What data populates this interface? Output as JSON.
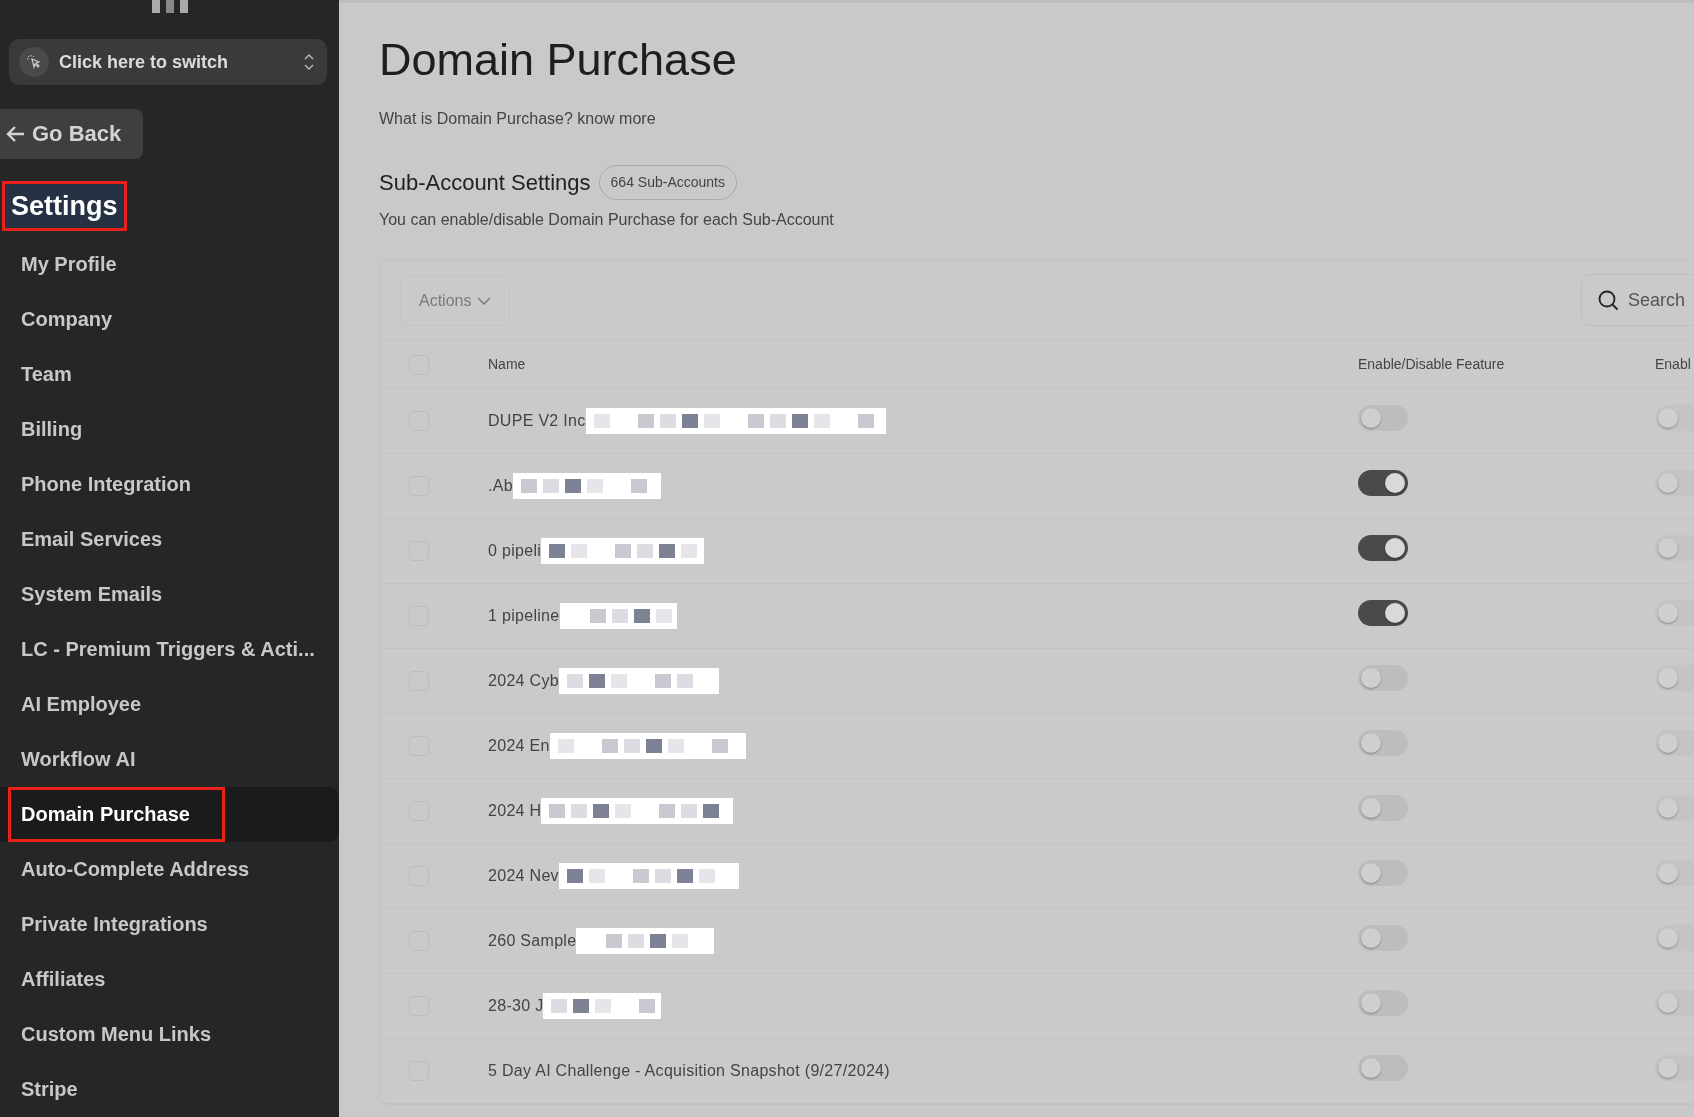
{
  "sidebar": {
    "switcher": {
      "label": "Click here to switch"
    },
    "back_button": "Go Back",
    "heading": {
      "text": "Settings",
      "annotated": true
    },
    "items": [
      {
        "label": "My Profile",
        "selected": false,
        "annotated": false
      },
      {
        "label": "Company",
        "selected": false,
        "annotated": false
      },
      {
        "label": "Team",
        "selected": false,
        "annotated": false
      },
      {
        "label": "Billing",
        "selected": false,
        "annotated": false
      },
      {
        "label": "Phone Integration",
        "selected": false,
        "annotated": false
      },
      {
        "label": "Email Services",
        "selected": false,
        "annotated": false
      },
      {
        "label": "System Emails",
        "selected": false,
        "annotated": false
      },
      {
        "label": "LC - Premium Triggers & Acti...",
        "selected": false,
        "annotated": false
      },
      {
        "label": "AI Employee",
        "selected": false,
        "annotated": false
      },
      {
        "label": "Workflow AI",
        "selected": false,
        "annotated": false
      },
      {
        "label": "Domain Purchase",
        "selected": true,
        "annotated": true
      },
      {
        "label": "Auto-Complete Address",
        "selected": false,
        "annotated": false
      },
      {
        "label": "Private Integrations",
        "selected": false,
        "annotated": false
      },
      {
        "label": "Affiliates",
        "selected": false,
        "annotated": false
      },
      {
        "label": "Custom Menu Links",
        "selected": false,
        "annotated": false
      },
      {
        "label": "Stripe",
        "selected": false,
        "annotated": false
      }
    ]
  },
  "page": {
    "title": "Domain Purchase",
    "subtitle": "What is Domain Purchase? know more",
    "section_title": "Sub-Account Settings",
    "count_badge": "664 Sub-Accounts",
    "section_note": "You can enable/disable Domain Purchase for each Sub-Account"
  },
  "table": {
    "actions_button": "Actions",
    "search": {
      "placeholder": "Search"
    },
    "select_all_checked": false,
    "columns": [
      "Name",
      "Enable/Disable Feature",
      "Enabl"
    ],
    "rows": [
      {
        "name": "DUPE V2 Inc",
        "redacted": true,
        "checked": false,
        "on": false,
        "on_2": false
      },
      {
        "name": ".Ab",
        "redacted": true,
        "checked": false,
        "on": true,
        "on_2": false
      },
      {
        "name": "0 pipeli",
        "redacted": true,
        "checked": false,
        "on": true,
        "on_2": false
      },
      {
        "name": "1 pipeline",
        "redacted": true,
        "checked": false,
        "on": true,
        "on_2": false
      },
      {
        "name": "2024 Cyb",
        "redacted": true,
        "checked": false,
        "on": false,
        "on_2": false
      },
      {
        "name": "2024 En",
        "redacted": true,
        "checked": false,
        "on": false,
        "on_2": false
      },
      {
        "name": "2024 H",
        "redacted": true,
        "checked": false,
        "on": false,
        "on_2": false
      },
      {
        "name": "2024 Nev",
        "redacted": true,
        "checked": false,
        "on": false,
        "on_2": false
      },
      {
        "name": "260 Sample",
        "redacted": true,
        "checked": false,
        "on": false,
        "on_2": false
      },
      {
        "name": "28-30 J",
        "redacted": true,
        "checked": false,
        "on": false,
        "on_2": false
      },
      {
        "name": "5 Day AI Challenge - Acquisition Snapshot (9/27/2024)",
        "redacted": false,
        "checked": false,
        "on": false,
        "on_2": false
      }
    ]
  }
}
